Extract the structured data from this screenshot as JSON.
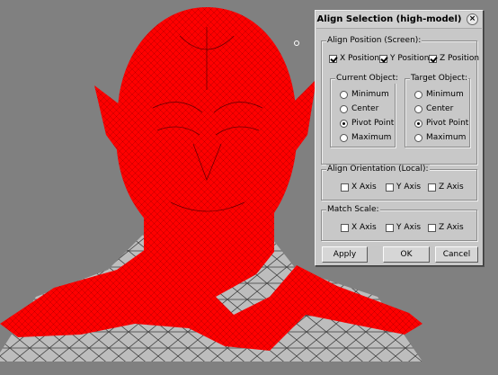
{
  "dialog": {
    "title": "Align Selection (high-model)",
    "close_glyph": "×",
    "align_position": {
      "label": "Align Position (Screen):",
      "x": {
        "label": "X Position",
        "checked": true
      },
      "y": {
        "label": "Y Position",
        "checked": true
      },
      "z": {
        "label": "Z Position",
        "checked": true
      }
    },
    "current_object": {
      "label": "Current Object:",
      "options": [
        "Minimum",
        "Center",
        "Pivot Point",
        "Maximum"
      ],
      "selected": "Pivot Point"
    },
    "target_object": {
      "label": "Target Object:",
      "options": [
        "Minimum",
        "Center",
        "Pivot Point",
        "Maximum"
      ],
      "selected": "Pivot Point"
    },
    "align_orientation": {
      "label": "Align Orientation (Local):",
      "x": {
        "label": "X Axis",
        "checked": false
      },
      "y": {
        "label": "Y Axis",
        "checked": false
      },
      "z": {
        "label": "Z Axis",
        "checked": false
      }
    },
    "match_scale": {
      "label": "Match Scale:",
      "x": {
        "label": "X Axis",
        "checked": false
      },
      "y": {
        "label": "Y Axis",
        "checked": false
      },
      "z": {
        "label": "Z Axis",
        "checked": false
      }
    },
    "buttons": {
      "apply": "Apply",
      "ok": "OK",
      "cancel": "Cancel"
    }
  },
  "colors": {
    "viewport_bg": "#808080",
    "selection": "#ff0000",
    "dialog_bg": "#c8c8c8"
  },
  "icons": {
    "close": "close-icon",
    "pivot": "pivot-icon"
  }
}
